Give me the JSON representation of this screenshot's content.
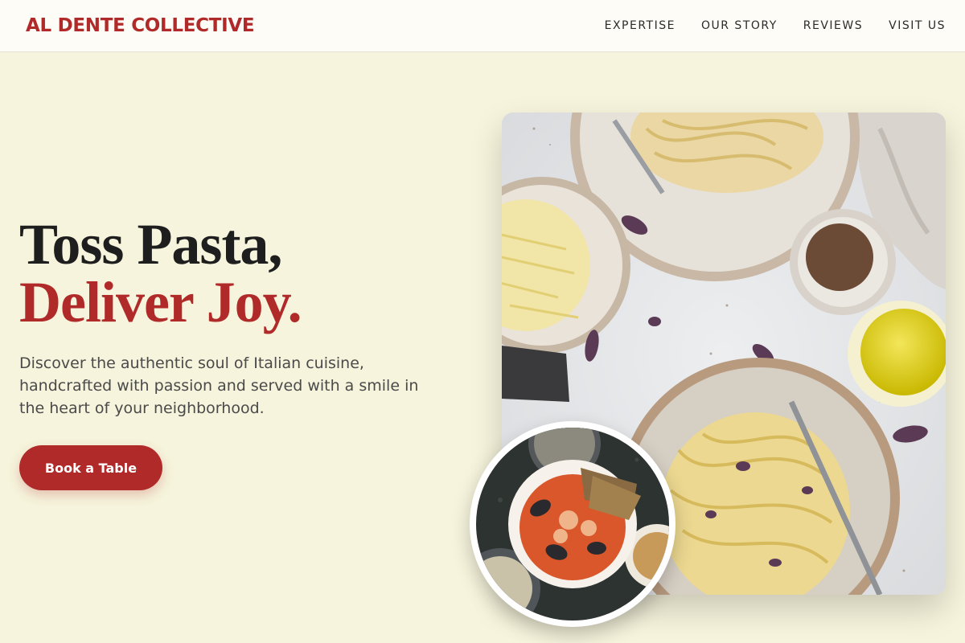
{
  "brand": {
    "name": "AL DENTE COLLECTIVE"
  },
  "nav": {
    "items": [
      {
        "label": "EXPERTISE"
      },
      {
        "label": "OUR STORY"
      },
      {
        "label": "REVIEWS"
      },
      {
        "label": "VISIT US"
      }
    ]
  },
  "hero": {
    "headline_line1": "Toss Pasta,",
    "headline_line2": "Deliver Joy.",
    "description": "Discover the authentic soul of Italian cuisine, handcrafted with passion and served with a smile in the heart of your neighborhood.",
    "cta_label": "Book a Table"
  },
  "images": {
    "main": "pasta-table-photo",
    "inset": "seafood-stew-photo"
  },
  "colors": {
    "accent": "#b12a2a",
    "background": "#f6f4dc",
    "header_bg": "#fdfcf7",
    "text_dark": "#1e1e1e",
    "text_body": "#4a4a4a"
  }
}
